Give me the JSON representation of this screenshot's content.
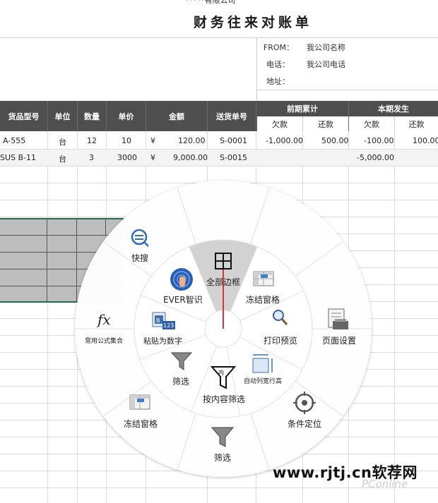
{
  "header": {
    "company": "*****有限公司",
    "title": "财务往来对账单"
  },
  "info": {
    "from_label": "FROM：",
    "from_value": "我公司名称",
    "phone_label": "电话：",
    "phone_value": "我公司电话",
    "address_label": "地址："
  },
  "table": {
    "columns": [
      "货品型号",
      "单位",
      "数量",
      "单价",
      "金额",
      "送货单号"
    ],
    "group_prev": "前期累计",
    "group_curr": "本期发生",
    "sub_debit": "欠款",
    "sub_repay": "还款",
    "rows": [
      {
        "model": "A-555",
        "unit": "台",
        "qty": "12",
        "price": "10",
        "cur": "¥",
        "amount": "120.00",
        "delivery": "S-0001",
        "prev_debit": "-1,000.00",
        "prev_repay": "500.00",
        "curr_debit": "-100.00",
        "curr_repay": "100.00"
      },
      {
        "model": "SUS B-11",
        "unit": "台",
        "qty": "3",
        "price": "3000",
        "cur": "¥",
        "amount": "9,000.00",
        "delivery": "S-0015",
        "prev_debit": "",
        "prev_repay": "",
        "curr_debit": "-5,000.00",
        "curr_repay": ""
      }
    ]
  },
  "menu": {
    "center": "全部边框",
    "items": {
      "search": "快搜",
      "ever": "EVER智识",
      "freeze_inner": "冻结窗格",
      "print_preview": "打印预览",
      "page_setup": "页面设置",
      "formulas": "常用公式集合",
      "paste_number": "粘贴为数字",
      "filter_inner": "筛选",
      "filter_content": "按内容筛选",
      "auto_width": "自动列宽行高",
      "locate": "条件定位",
      "freeze_outer": "冻结窗格",
      "filter_outer": "筛选"
    },
    "badge_123": "123"
  },
  "watermark": {
    "main": "www.rjtj.cn软荐网",
    "brand": "PConline"
  },
  "colors": {
    "header_bg": "#4e4e4e",
    "selection_border": "#1e7145",
    "selection_fill": "#bdbdbd",
    "accent_red": "#e03030",
    "icon_blue": "#2f6db3"
  }
}
